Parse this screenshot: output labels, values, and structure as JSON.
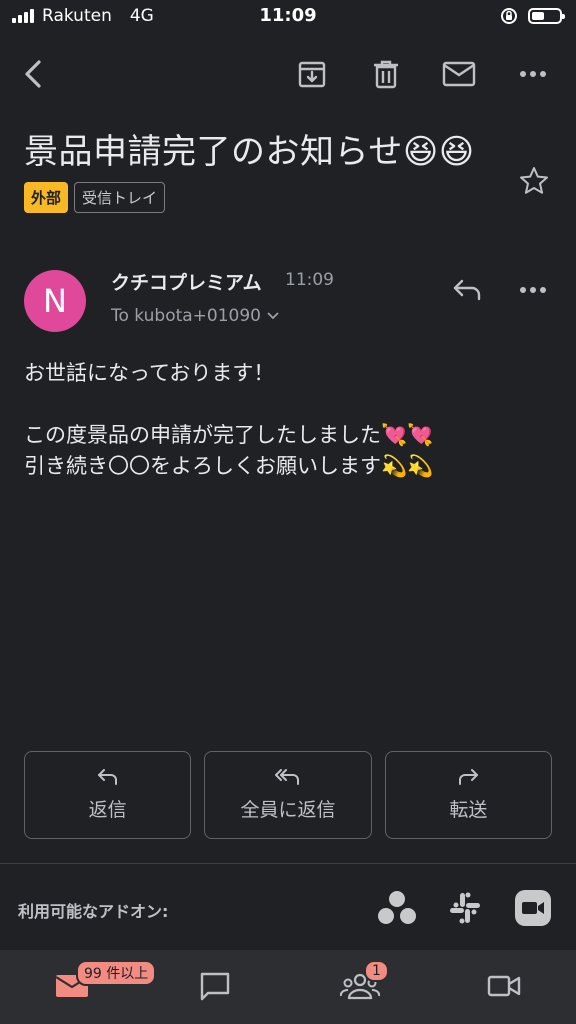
{
  "status_bar": {
    "carrier": "Rakuten",
    "network": "4G",
    "time": "11:09"
  },
  "toolbar": {
    "back": "back-icon",
    "archive": "archive-icon",
    "delete": "trash-icon",
    "mark_unread": "mail-icon",
    "more": "more-icon"
  },
  "email": {
    "subject": "景品申請完了のお知らせ😆😆",
    "labels": [
      "外部",
      "受信トレイ"
    ],
    "sender": {
      "initial": "N",
      "name": "クチコプレミアム",
      "time": "11:09",
      "to": "To kubota+01090"
    },
    "body": [
      "お世話になっております！",
      "この度景品の申請が完了したしました💘💘",
      "引き続き〇〇をよろしくお願いします💫💫"
    ]
  },
  "actions": {
    "reply": "返信",
    "reply_all": "全員に返信",
    "forward": "転送"
  },
  "addons": {
    "label": "利用可能なアドオン:",
    "items": [
      "asana-icon",
      "slack-icon",
      "zoom-icon"
    ]
  },
  "bottom_nav": {
    "mail_badge": "99 件以上",
    "meet_badge": "1"
  },
  "colors": {
    "background": "#202124",
    "avatar": "#e0489a",
    "external_chip": "#f9b925",
    "badge": "#f28b82"
  }
}
